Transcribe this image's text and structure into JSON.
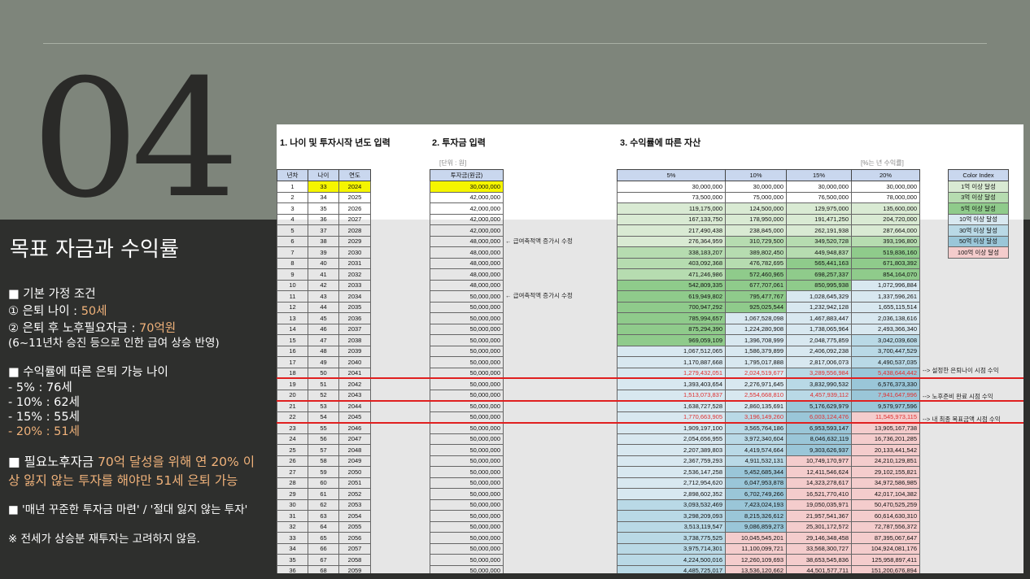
{
  "slide": {
    "number": "04",
    "title": "목표 자금과 수익률",
    "basic_header": "■ 기본 가정 조건",
    "basic_1_pre": "① 은퇴 나이 : ",
    "basic_1_val": "50세",
    "basic_2_pre": "② 은퇴 후 노후필요자금 : ",
    "basic_2_val": "70억원",
    "basic_3": "(6~11년차 승진 등으로 인한 급여 상승 반영)",
    "rate_header": "■ 수익률에 따른 은퇴 가능 나이",
    "rate_1": "- 5%   : 76세",
    "rate_2": "- 10% : 62세",
    "rate_3": "- 15% : 55세",
    "rate_4": "- 20% : 51세",
    "goal_1_pre": "■ 필요노후자금 ",
    "goal_1_val": "70억 달성을 위해 연 20% 이",
    "goal_2": "상 잃지 않는 투자를 해야만 51세 은퇴 가능",
    "quote": "■ '매년 꾸준한 투자금 마련' / '절대 잃지 않는 투자'",
    "footnote": "※ 전세가 상승분 재투자는 고려하지 않음."
  },
  "sheet": {
    "section1": "1. 나이 및 투자시작 년도 입력",
    "section2": "2. 투자금 입력",
    "section3": "3. 수익률에 따른 자산",
    "unit_label": "[단위 : 원]",
    "rate_label": "[%는 년 수익률]",
    "headers": {
      "year_no": "년차",
      "age": "나이",
      "year": "연도",
      "invest": "투자금(원금)",
      "r5": "5%",
      "r10": "10%",
      "r15": "15%",
      "r20": "20%"
    },
    "notes": {
      "salary_6": "← 급여축적액 증가시 수정",
      "salary_11": "← 급여축적액 증가시 수정",
      "retire_age": "--> 설정한 은퇴나이 시점 수익",
      "ready": "--> 노후준비 완료 시점 수익",
      "goal": "--> 내 최종 목표금액 시점 수익"
    },
    "color_index": {
      "header": "Color Index",
      "items": [
        "1억 이상 달성",
        "3억 이상 달성",
        "5억 이상 달성",
        "10억 이상 달성",
        "30억 이상 달성",
        "50억 이상 달성",
        "100억 이상 달성"
      ],
      "colors": [
        "#d9ead3",
        "#b6dcb0",
        "#8fcb8b",
        "#d8e8f0",
        "#b9d9e6",
        "#9ac6d8",
        "#f4cccc"
      ]
    },
    "rows": [
      [
        "1",
        "33",
        "2024",
        "30,000,000",
        "30,000,000",
        "30,000,000",
        "30,000,000",
        "30,000,000"
      ],
      [
        "2",
        "34",
        "2025",
        "42,000,000",
        "73,500,000",
        "75,000,000",
        "76,500,000",
        "78,000,000"
      ],
      [
        "3",
        "35",
        "2026",
        "42,000,000",
        "119,175,000",
        "124,500,000",
        "129,975,000",
        "135,600,000"
      ],
      [
        "4",
        "36",
        "2027",
        "42,000,000",
        "167,133,750",
        "178,950,000",
        "191,471,250",
        "204,720,000"
      ],
      [
        "5",
        "37",
        "2028",
        "42,000,000",
        "217,490,438",
        "238,845,000",
        "262,191,938",
        "287,664,000"
      ],
      [
        "6",
        "38",
        "2029",
        "48,000,000",
        "276,364,959",
        "310,729,500",
        "349,520,728",
        "393,196,800"
      ],
      [
        "7",
        "39",
        "2030",
        "48,000,000",
        "338,183,207",
        "389,802,450",
        "449,948,837",
        "519,836,160"
      ],
      [
        "8",
        "40",
        "2031",
        "48,000,000",
        "403,092,368",
        "476,782,695",
        "565,441,163",
        "671,803,392"
      ],
      [
        "9",
        "41",
        "2032",
        "48,000,000",
        "471,246,986",
        "572,460,965",
        "698,257,337",
        "854,164,070"
      ],
      [
        "10",
        "42",
        "2033",
        "48,000,000",
        "542,809,335",
        "677,707,061",
        "850,995,938",
        "1,072,996,884"
      ],
      [
        "11",
        "43",
        "2034",
        "50,000,000",
        "619,949,802",
        "795,477,767",
        "1,028,645,329",
        "1,337,596,261"
      ],
      [
        "12",
        "44",
        "2035",
        "50,000,000",
        "700,947,292",
        "925,025,544",
        "1,232,942,128",
        "1,655,115,514"
      ],
      [
        "13",
        "45",
        "2036",
        "50,000,000",
        "785,994,657",
        "1,067,528,098",
        "1,467,883,447",
        "2,036,138,616"
      ],
      [
        "14",
        "46",
        "2037",
        "50,000,000",
        "875,294,390",
        "1,224,280,908",
        "1,738,065,964",
        "2,493,366,340"
      ],
      [
        "15",
        "47",
        "2038",
        "50,000,000",
        "969,059,109",
        "1,396,708,999",
        "2,048,775,859",
        "3,042,039,608"
      ],
      [
        "16",
        "48",
        "2039",
        "50,000,000",
        "1,067,512,065",
        "1,586,379,899",
        "2,406,092,238",
        "3,700,447,529"
      ],
      [
        "17",
        "49",
        "2040",
        "50,000,000",
        "1,170,887,668",
        "1,795,017,888",
        "2,817,006,073",
        "4,490,537,035"
      ],
      [
        "18",
        "50",
        "2041",
        "50,000,000",
        "1,279,432,051",
        "2,024,519,677",
        "3,289,556,984",
        "5,438,644,442"
      ],
      [
        "19",
        "51",
        "2042",
        "50,000,000",
        "1,393,403,654",
        "2,276,971,645",
        "3,832,990,532",
        "6,576,373,330"
      ],
      [
        "20",
        "52",
        "2043",
        "50,000,000",
        "1,513,073,837",
        "2,554,668,810",
        "4,457,939,112",
        "7,941,647,996"
      ],
      [
        "21",
        "53",
        "2044",
        "50,000,000",
        "1,638,727,528",
        "2,860,135,691",
        "5,176,629,979",
        "9,579,977,596"
      ],
      [
        "22",
        "54",
        "2045",
        "50,000,000",
        "1,770,663,905",
        "3,196,149,260",
        "6,003,124,476",
        "11,545,973,115"
      ],
      [
        "23",
        "55",
        "2046",
        "50,000,000",
        "1,909,197,100",
        "3,565,764,186",
        "6,953,593,147",
        "13,905,167,738"
      ],
      [
        "24",
        "56",
        "2047",
        "50,000,000",
        "2,054,656,955",
        "3,972,340,604",
        "8,046,632,119",
        "16,736,201,285"
      ],
      [
        "25",
        "57",
        "2048",
        "50,000,000",
        "2,207,389,803",
        "4,419,574,664",
        "9,303,626,937",
        "20,133,441,542"
      ],
      [
        "26",
        "58",
        "2049",
        "50,000,000",
        "2,367,759,293",
        "4,911,532,131",
        "10,749,170,977",
        "24,210,129,851"
      ],
      [
        "27",
        "59",
        "2050",
        "50,000,000",
        "2,536,147,258",
        "5,452,685,344",
        "12,411,546,624",
        "29,102,155,821"
      ],
      [
        "28",
        "60",
        "2051",
        "50,000,000",
        "2,712,954,620",
        "6,047,953,878",
        "14,323,278,617",
        "34,972,586,985"
      ],
      [
        "29",
        "61",
        "2052",
        "50,000,000",
        "2,898,602,352",
        "6,702,749,266",
        "16,521,770,410",
        "42,017,104,382"
      ],
      [
        "30",
        "62",
        "2053",
        "50,000,000",
        "3,093,532,469",
        "7,423,024,193",
        "19,050,035,971",
        "50,470,525,259"
      ],
      [
        "31",
        "63",
        "2054",
        "50,000,000",
        "3,298,209,093",
        "8,215,326,612",
        "21,957,541,367",
        "60,614,630,310"
      ],
      [
        "32",
        "64",
        "2055",
        "50,000,000",
        "3,513,119,547",
        "9,086,859,273",
        "25,301,172,572",
        "72,787,556,372"
      ],
      [
        "33",
        "65",
        "2056",
        "50,000,000",
        "3,738,775,525",
        "10,045,545,201",
        "29,146,348,458",
        "87,395,067,647"
      ],
      [
        "34",
        "66",
        "2057",
        "50,000,000",
        "3,975,714,301",
        "11,100,099,721",
        "33,568,300,727",
        "104,924,081,176"
      ],
      [
        "35",
        "67",
        "2058",
        "50,000,000",
        "4,224,500,016",
        "12,260,109,693",
        "38,653,545,836",
        "125,958,897,411"
      ],
      [
        "36",
        "68",
        "2059",
        "50,000,000",
        "4,485,725,017",
        "13,536,120,662",
        "44,501,577,711",
        "151,200,676,894"
      ]
    ]
  }
}
